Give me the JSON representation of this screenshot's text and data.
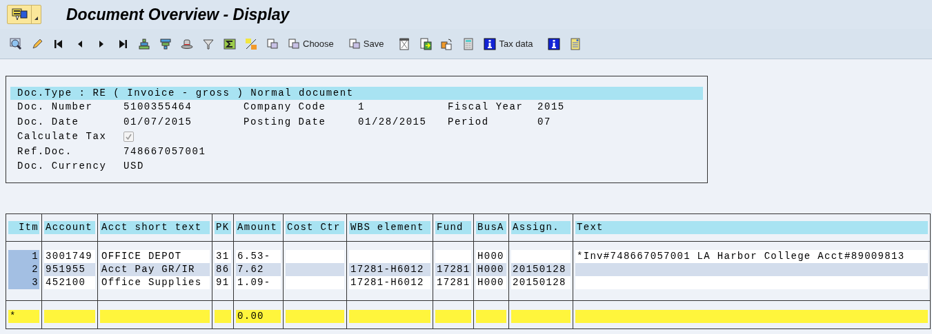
{
  "window": {
    "title": "Document Overview - Display"
  },
  "toolbar": [
    {
      "label": "Choose"
    },
    {
      "label": "Save"
    },
    {
      "label": "Tax data"
    }
  ],
  "header": {
    "doc_type": "Doc.Type : RE ( Invoice - gross ) Normal document",
    "rows": [
      [
        {
          "label": "Doc. Number",
          "value": "5100355464"
        },
        {
          "label": "Company Code",
          "value": "1"
        },
        {
          "label": "Fiscal Year",
          "value": "2015"
        }
      ],
      [
        {
          "label": "Doc. Date",
          "value": "01/07/2015"
        },
        {
          "label": "Posting Date",
          "value": "01/28/2015"
        },
        {
          "label": "Period",
          "value": "07"
        }
      ],
      [
        {
          "label": "Calculate Tax",
          "kind": "checkbox",
          "checked": true
        }
      ],
      [
        {
          "label": "Ref.Doc.",
          "value": "748667057001"
        }
      ],
      [
        {
          "label": "Doc. Currency",
          "value": "USD"
        }
      ]
    ]
  },
  "table": {
    "columns": [
      "Itm",
      "Account",
      "Acct short text",
      "PK",
      "Amount",
      "Cost Ctr",
      "WBS element",
      "Fund",
      "BusA",
      "Assign.",
      "Text"
    ],
    "rows": [
      [
        "1",
        "3001749",
        "OFFICE DEPOT",
        "31",
        "6.53-",
        null,
        null,
        null,
        "H000",
        null,
        "*Inv#748667057001 LA Harbor College Acct#89009813"
      ],
      [
        "2",
        "951955",
        "Acct Pay GR/IR",
        "86",
        "7.62",
        null,
        "17281-H6012",
        "17281",
        "H000",
        "20150128",
        null
      ],
      [
        "3",
        "452100",
        "Office Supplies",
        "91",
        "1.09-",
        null,
        "17281-H6012",
        "17281",
        "H000",
        "20150128",
        null
      ]
    ],
    "total": {
      "marker": "*",
      "amount": "0.00"
    }
  }
}
